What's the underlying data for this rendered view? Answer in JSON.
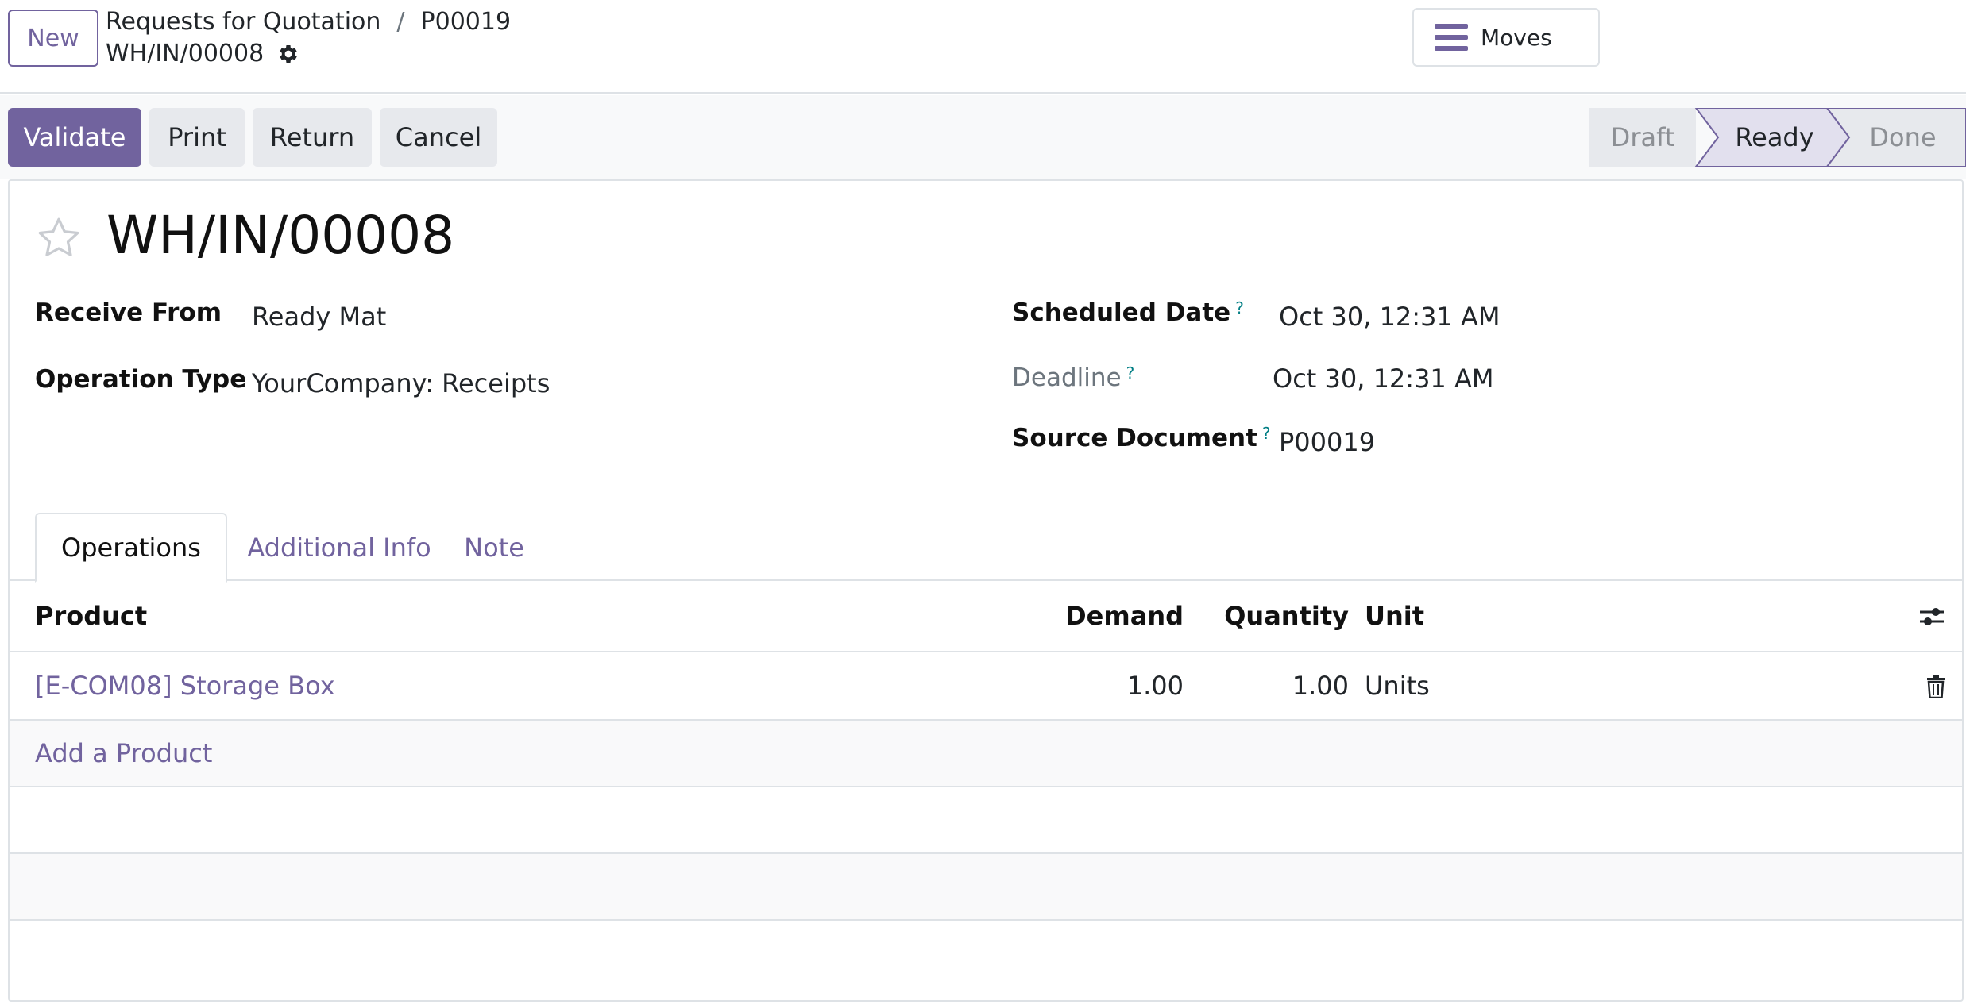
{
  "header": {
    "new_label": "New",
    "breadcrumb": [
      "Requests for Quotation",
      "P00019"
    ],
    "breadcrumb_sep": "/",
    "record_name": "WH/IN/00008",
    "moves_label": "Moves"
  },
  "actions": {
    "validate": "Validate",
    "print": "Print",
    "return": "Return",
    "cancel": "Cancel"
  },
  "status": {
    "stages": [
      "Draft",
      "Ready",
      "Done"
    ],
    "current": "Ready"
  },
  "form": {
    "title": "WH/IN/00008",
    "receive_from_label": "Receive From",
    "receive_from": "Ready Mat",
    "operation_type_label": "Operation Type",
    "operation_type": "YourCompany: Receipts",
    "scheduled_date_label": "Scheduled Date",
    "scheduled_date": "Oct 30, 12:31 AM",
    "deadline_label": "Deadline",
    "deadline": "Oct 30, 12:31 AM",
    "source_document_label": "Source Document",
    "source_document": "P00019",
    "help_mark": "?"
  },
  "tabs": [
    "Operations",
    "Additional Info",
    "Note"
  ],
  "table": {
    "columns": [
      "Product",
      "Demand",
      "Quantity",
      "Unit"
    ],
    "rows": [
      {
        "product": "[E-COM08] Storage Box",
        "demand": "1.00",
        "quantity": "1.00",
        "unit": "Units"
      }
    ],
    "add_product": "Add a Product"
  },
  "colors": {
    "primary": "#71639e",
    "help": "#017e84"
  },
  "icons": [
    "gear-icon",
    "hamburger-icon",
    "star-icon",
    "optional-columns-icon",
    "trash-icon"
  ]
}
